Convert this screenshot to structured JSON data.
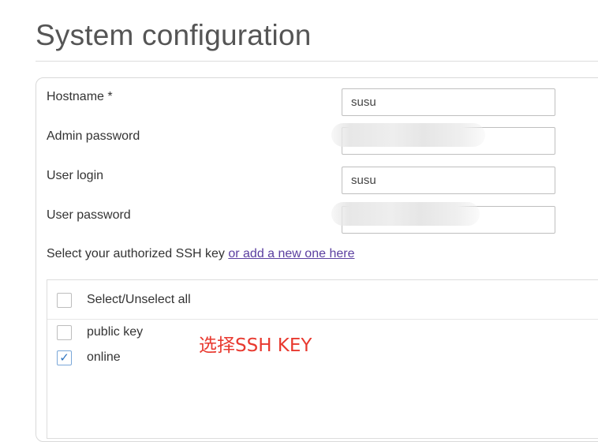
{
  "page": {
    "title": "System configuration"
  },
  "form": {
    "hostname": {
      "label": "Hostname *",
      "value": "susu"
    },
    "admin_password": {
      "label": "Admin password",
      "value": ""
    },
    "user_login": {
      "label": "User login",
      "value": "susu"
    },
    "user_password": {
      "label": "User password",
      "value": ""
    }
  },
  "ssh": {
    "prompt": "Select your authorized SSH key",
    "add_link": "or add a new one here",
    "select_all_label": "Select/Unselect all",
    "keys": [
      {
        "label": "public key",
        "checked": false
      },
      {
        "label": "online",
        "checked": true
      }
    ]
  },
  "annotation": {
    "text": "选择SSH KEY",
    "color": "#e8392f"
  }
}
